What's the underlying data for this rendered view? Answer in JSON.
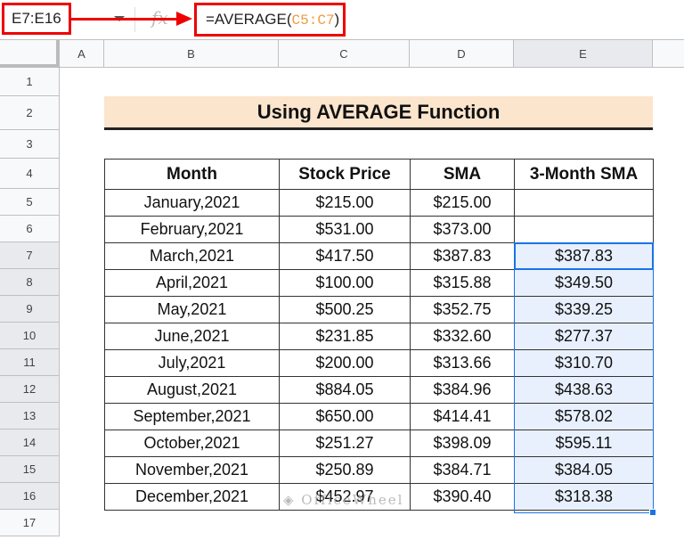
{
  "formula_bar": {
    "name_box": "E7:E16",
    "formula_prefix": "=AVERAGE(",
    "formula_ref": "C5:C7",
    "formula_suffix": ")",
    "fx_label": "fx"
  },
  "columns": [
    "A",
    "B",
    "C",
    "D",
    "E"
  ],
  "rows": [
    "1",
    "2",
    "3",
    "4",
    "5",
    "6",
    "7",
    "8",
    "9",
    "10",
    "11",
    "12",
    "13",
    "14",
    "15",
    "16",
    "17"
  ],
  "title": "Using AVERAGE Function",
  "table": {
    "headers": [
      "Month",
      "Stock Price",
      "SMA",
      "3-Month SMA"
    ],
    "rows": [
      [
        "January,2021",
        "$215.00",
        "$215.00",
        ""
      ],
      [
        "February,2021",
        "$531.00",
        "$373.00",
        ""
      ],
      [
        "March,2021",
        "$417.50",
        "$387.83",
        "$387.83"
      ],
      [
        "April,2021",
        "$100.00",
        "$315.88",
        "$349.50"
      ],
      [
        "May,2021",
        "$500.25",
        "$352.75",
        "$339.25"
      ],
      [
        "June,2021",
        "$231.85",
        "$332.60",
        "$277.37"
      ],
      [
        "July,2021",
        "$200.00",
        "$313.66",
        "$310.70"
      ],
      [
        "August,2021",
        "$884.05",
        "$384.96",
        "$438.63"
      ],
      [
        "September,2021",
        "$650.00",
        "$414.41",
        "$578.02"
      ],
      [
        "October,2021",
        "$251.27",
        "$398.09",
        "$595.11"
      ],
      [
        "November,2021",
        "$250.89",
        "$384.71",
        "$384.05"
      ],
      [
        "December,2021",
        "$452.97",
        "$390.40",
        "$318.38"
      ]
    ]
  },
  "watermark": "OfficeWheel",
  "colors": {
    "highlight": "#e00000",
    "selection": "#1a73e8",
    "title_bg": "#fce5cd"
  }
}
